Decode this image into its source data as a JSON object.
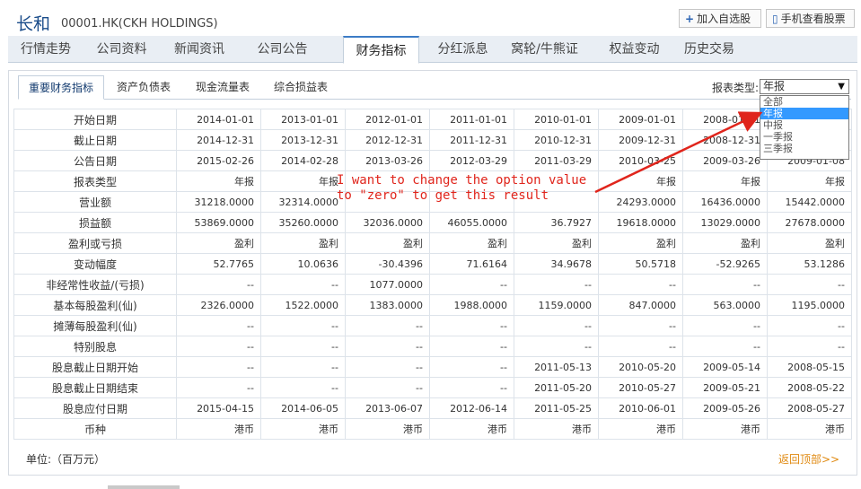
{
  "header": {
    "title": "长和",
    "subtitle": "00001.HK(CKH HOLDINGS)",
    "add_watchlist": "加入自选股",
    "mobile_view": "手机查看股票"
  },
  "nav": {
    "tabs": [
      "行情走势",
      "公司资料",
      "新闻资讯",
      "公司公告",
      "财务指标",
      "分红派息",
      "窝轮/牛熊证",
      "权益变动",
      "历史交易"
    ],
    "active": "财务指标"
  },
  "subnav": {
    "tabs": [
      "重要财务指标",
      "资产负债表",
      "现金流量表",
      "综合损益表"
    ],
    "active": "重要财务指标"
  },
  "report_type": {
    "label": "报表类型:",
    "selected": "年报",
    "options": [
      "全部",
      "年报",
      "中报",
      "一季报",
      "三季报"
    ]
  },
  "annotation": {
    "line1": "I want to change the option value",
    "line2": "to \"zero\" to get this result"
  },
  "table": {
    "rows": [
      {
        "label": "开始日期",
        "values": [
          "2014-01-01",
          "2013-01-01",
          "2012-01-01",
          "2011-01-01",
          "2010-01-01",
          "2009-01-01",
          "2008-01-01",
          ""
        ]
      },
      {
        "label": "截止日期",
        "values": [
          "2014-12-31",
          "2013-12-31",
          "2012-12-31",
          "2011-12-31",
          "2010-12-31",
          "2009-12-31",
          "2008-12-31",
          ""
        ]
      },
      {
        "label": "公告日期",
        "values": [
          "2015-02-26",
          "2014-02-28",
          "2013-03-26",
          "2012-03-29",
          "2011-03-29",
          "2010-03-25",
          "2009-03-26",
          "2009-01-08"
        ]
      },
      {
        "label": "报表类型",
        "values": [
          "年报",
          "年报",
          "",
          "",
          "",
          "年报",
          "年报",
          "年报"
        ]
      },
      {
        "label": "营业额",
        "values": [
          "31218.0000",
          "32314.0000",
          "",
          "",
          "",
          "24293.0000",
          "16436.0000",
          "15442.0000"
        ]
      },
      {
        "label": "损益额",
        "values": [
          "53869.0000",
          "35260.0000",
          "32036.0000",
          "46055.0000",
          "36.7927",
          "19618.0000",
          "13029.0000",
          "27678.0000"
        ]
      },
      {
        "label": "盈利或亏损",
        "values": [
          "盈利",
          "盈利",
          "盈利",
          "盈利",
          "盈利",
          "盈利",
          "盈利",
          "盈利"
        ]
      },
      {
        "label": "变动幅度",
        "values": [
          "52.7765",
          "10.0636",
          "-30.4396",
          "71.6164",
          "34.9678",
          "50.5718",
          "-52.9265",
          "53.1286"
        ]
      },
      {
        "label": "非经常性收益/(亏损)",
        "values": [
          "--",
          "--",
          "1077.0000",
          "--",
          "--",
          "--",
          "--",
          "--"
        ]
      },
      {
        "label": "基本每股盈利(仙)",
        "values": [
          "2326.0000",
          "1522.0000",
          "1383.0000",
          "1988.0000",
          "1159.0000",
          "847.0000",
          "563.0000",
          "1195.0000"
        ]
      },
      {
        "label": "摊薄每股盈利(仙)",
        "values": [
          "--",
          "--",
          "--",
          "--",
          "--",
          "--",
          "--",
          "--"
        ]
      },
      {
        "label": "特别股息",
        "values": [
          "--",
          "--",
          "--",
          "--",
          "--",
          "--",
          "--",
          "--"
        ]
      },
      {
        "label": "股息截止日期开始",
        "values": [
          "--",
          "--",
          "--",
          "--",
          "2011-05-13",
          "2010-05-20",
          "2009-05-14",
          "2008-05-15"
        ]
      },
      {
        "label": "股息截止日期结束",
        "values": [
          "--",
          "--",
          "--",
          "--",
          "2011-05-20",
          "2010-05-27",
          "2009-05-21",
          "2008-05-22"
        ]
      },
      {
        "label": "股息应付日期",
        "values": [
          "2015-04-15",
          "2014-06-05",
          "2013-06-07",
          "2012-06-14",
          "2011-05-25",
          "2010-06-01",
          "2009-05-26",
          "2008-05-27"
        ]
      },
      {
        "label": "币种",
        "values": [
          "港币",
          "港币",
          "港币",
          "港币",
          "港币",
          "港币",
          "港币",
          "港币"
        ]
      }
    ]
  },
  "footer": {
    "unit": "单位:（百万元）",
    "back_to_top": "返回顶部>>"
  },
  "colors": {
    "accent": "#3c7cc6",
    "annotation": "#e0251c",
    "link": "#e08a12",
    "selected_option": "#3399ff"
  }
}
